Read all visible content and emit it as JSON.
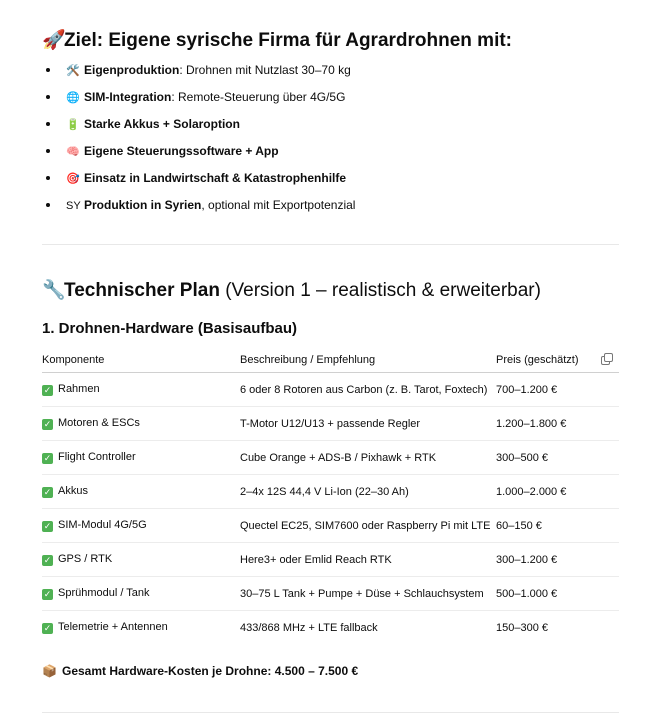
{
  "goal": {
    "emoji": "🚀",
    "title": "Ziel: Eigene syrische Firma für Agrardrohnen mit:",
    "items": [
      {
        "icon": "🛠️",
        "bold": "Eigenproduktion",
        "rest": ": Drohnen mit Nutzlast 30–70 kg"
      },
      {
        "icon": "🌐",
        "bold": "SIM-Integration",
        "rest": ": Remote-Steuerung über 4G/5G"
      },
      {
        "icon": "🔋",
        "bold": "Starke Akkus + Solaroption",
        "rest": ""
      },
      {
        "icon": "🧠",
        "bold": "Eigene Steuerungssoftware + App",
        "rest": ""
      },
      {
        "icon": "🎯",
        "bold": "Einsatz in Landwirtschaft & Katastrophenhilfe",
        "rest": ""
      },
      {
        "icon": "SY",
        "bold": "Produktion in Syrien",
        "rest": ", optional mit Exportpotenzial"
      }
    ]
  },
  "tech": {
    "emoji": "🔧",
    "title_bold": "Technischer Plan",
    "title_rest": " (Version 1 – realistisch & erweiterbar)"
  },
  "hardware": {
    "heading": "1. Drohnen-Hardware (Basisaufbau)",
    "columns": [
      "Komponente",
      "Beschreibung / Empfehlung",
      "Preis (geschätzt)"
    ],
    "rows": [
      {
        "component": "Rahmen",
        "description": "6 oder 8 Rotoren aus Carbon (z. B. Tarot, Foxtech)",
        "price": "700–1.200 €"
      },
      {
        "component": "Motoren & ESCs",
        "description": "T-Motor U12/U13 + passende Regler",
        "price": "1.200–1.800 €"
      },
      {
        "component": "Flight Controller",
        "description": "Cube Orange + ADS-B / Pixhawk + RTK",
        "price": "300–500 €"
      },
      {
        "component": "Akkus",
        "description": "2–4x 12S 44,4 V Li-Ion (22–30 Ah)",
        "price": "1.000–2.000 €"
      },
      {
        "component": "SIM-Modul 4G/5G",
        "description": "Quectel EC25, SIM7600 oder Raspberry Pi mit LTE",
        "price": "60–150 €"
      },
      {
        "component": "GPS / RTK",
        "description": "Here3+ oder Emlid Reach RTK",
        "price": "300–1.200 €"
      },
      {
        "component": "Sprühmodul / Tank",
        "description": "30–75 L Tank + Pumpe + Düse + Schlauchsystem",
        "price": "500–1.000 €"
      },
      {
        "component": "Telemetrie + Antennen",
        "description": "433/868 MHz + LTE fallback",
        "price": "150–300 €"
      }
    ],
    "total_icon": "📦",
    "total": "Gesamt Hardware-Kosten je Drohne: 4.500 – 7.500 €"
  }
}
